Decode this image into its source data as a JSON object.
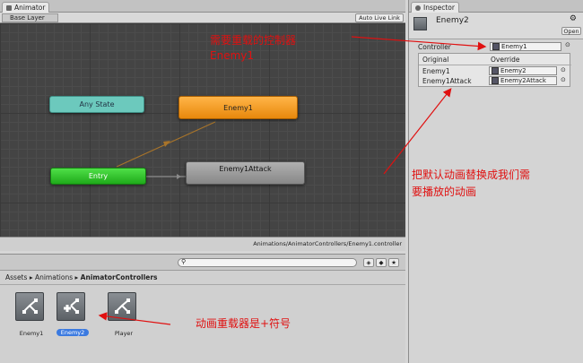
{
  "animator": {
    "tab_title": "Animator",
    "layer": "Base Layer",
    "auto_live_link": "Auto Live Link",
    "path": "Animations/AnimatorControllers/Enemy1.controller",
    "nodes": {
      "any_state": "Any State",
      "enemy1": "Enemy1",
      "entry": "Entry",
      "enemy1attack": "Enemy1Attack"
    }
  },
  "inspector": {
    "tab_title": "Inspector",
    "object_name": "Enemy2",
    "open_label": "Open",
    "controller_label": "Controller",
    "controller_value": "Enemy1",
    "col_original": "Original",
    "col_override": "Override",
    "rows": [
      {
        "original": "Enemy1",
        "override": "Enemy2"
      },
      {
        "original": "Enemy1Attack",
        "override": "Enemy2Attack"
      }
    ]
  },
  "project": {
    "breadcrumb": [
      "Assets",
      "Animations",
      "AnimatorControllers"
    ],
    "assets": [
      {
        "name": "Enemy1",
        "selected": false
      },
      {
        "name": "Enemy2",
        "selected": true
      },
      {
        "name": "Player",
        "selected": false
      }
    ]
  },
  "annotations": {
    "controller_note_line1": "需要重载的控制器",
    "controller_note_line2": "Enemy1",
    "replace_note_line1": "把默认动画替换成我们需",
    "replace_note_line2": "要播放的动画",
    "override_note": "动画重载器是+符号"
  },
  "colors": {
    "any_state": "#6cc9bd",
    "enemy1": "#f39a1a",
    "entry": "#2fc92a",
    "enemy1attack": "#9a9a9a",
    "annotation": "#e01010",
    "selected_label": "#3b7ae0"
  }
}
